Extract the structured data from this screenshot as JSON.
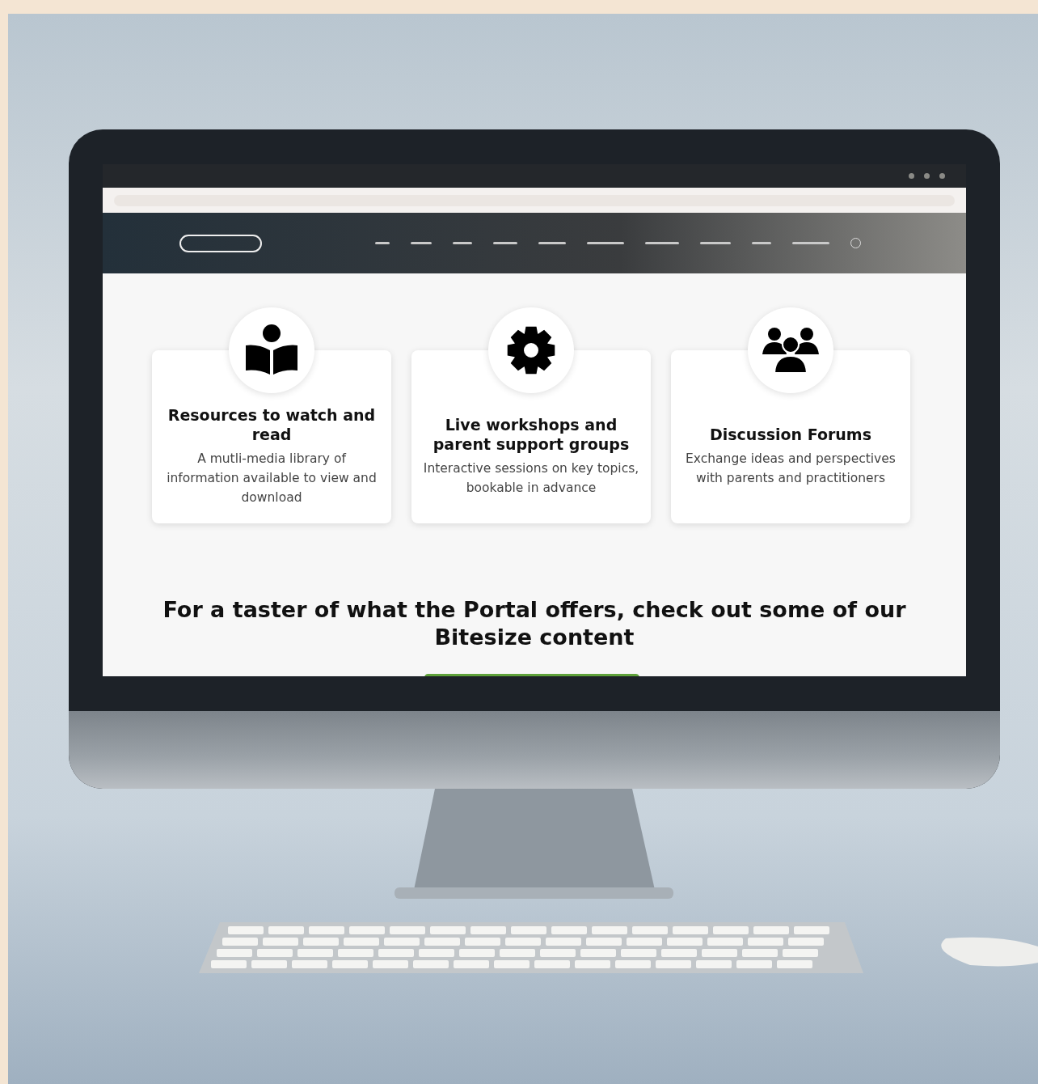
{
  "features": [
    {
      "kind": "book",
      "title": "Resources to watch and read",
      "description": "A mutli-media library of information available to view and download"
    },
    {
      "kind": "gear",
      "title": "Live workshops and parent support groups",
      "description": "Interactive sessions on key topics, bookable in advance"
    },
    {
      "kind": "people",
      "title": "Discussion Forums",
      "description": "Exchange ideas and perspectives with parents and practitioners"
    }
  ],
  "teaser": {
    "heading": "For a taster of what the Portal offers, check out some of our Bitesize content"
  }
}
